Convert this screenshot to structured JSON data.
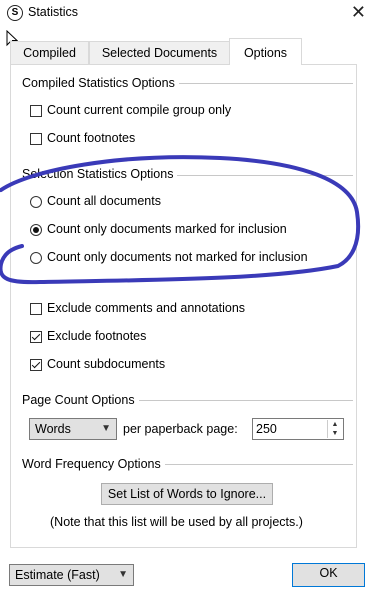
{
  "window": {
    "title": "Statistics",
    "close_glyph": "✕",
    "app_icon_glyph": "S"
  },
  "tabs": [
    {
      "label": "Compiled",
      "active": false
    },
    {
      "label": "Selected Documents",
      "active": false
    },
    {
      "label": "Options",
      "active": true
    }
  ],
  "compiled_group": {
    "label": "Compiled Statistics Options",
    "options": [
      {
        "label": "Count current compile group only",
        "checked": false
      },
      {
        "label": "Count footnotes",
        "checked": false
      }
    ]
  },
  "selection_group": {
    "label": "Selection Statistics Options",
    "radios": [
      {
        "label": "Count all documents",
        "selected": false
      },
      {
        "label": "Count only documents marked for inclusion",
        "selected": true
      },
      {
        "label": "Count only documents not marked for inclusion",
        "selected": false
      }
    ],
    "checks": [
      {
        "label": "Exclude comments and annotations",
        "checked": false
      },
      {
        "label": "Exclude footnotes",
        "checked": true
      },
      {
        "label": "Count subdocuments",
        "checked": true
      }
    ]
  },
  "page_count": {
    "label": "Page Count Options",
    "unit_value": "Words",
    "per_label": "per paperback page:",
    "value": "250"
  },
  "word_freq": {
    "label": "Word Frequency Options",
    "button_label": "Set List of Words to Ignore...",
    "note": "(Note that this list will be used by all projects.)"
  },
  "footer": {
    "estimate_value": "Estimate (Fast)",
    "ok_label": "OK"
  },
  "annotation_color": "#3a3ab8"
}
